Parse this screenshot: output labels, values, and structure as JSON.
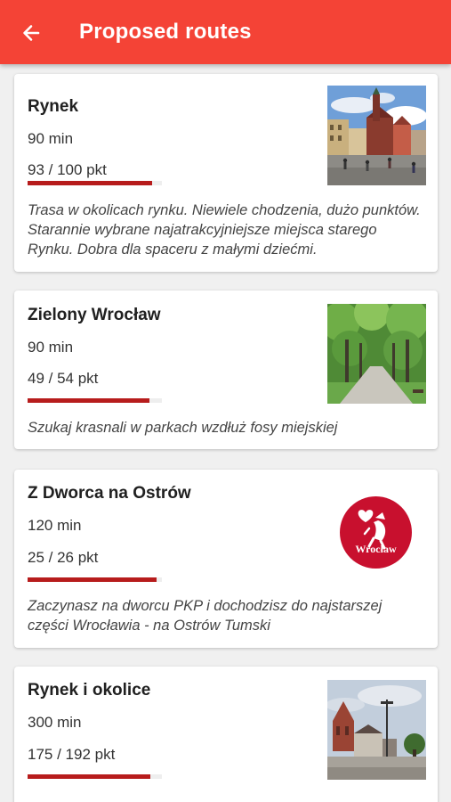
{
  "appbar": {
    "title": "Proposed routes",
    "back_icon": "arrow-left-icon",
    "color": "#f44336"
  },
  "accent_color": "#b71c1c",
  "routes": [
    {
      "name": "Rynek",
      "duration": "90 min",
      "points": "93 / 100 pkt",
      "progress": 0.93,
      "description": "Trasa w okolicach rynku. Niewiele chodzenia, dużo punktów. Starannie wybrane najatrakcyjniejsze miejsca starego Rynku. Dobra dla spaceru z małymi dziećmi.",
      "image": "market-square-photo"
    },
    {
      "name": "Zielony Wrocław",
      "duration": "90 min",
      "points": "49 / 54 pkt",
      "progress": 0.907,
      "description": "Szukaj krasnali w parkach wzdłuż fosy miejskiej",
      "image": "park-alley-photo"
    },
    {
      "name": "Z Dworca na Ostrów",
      "duration": "120 min",
      "points": "25 / 26 pkt",
      "progress": 0.96,
      "description": "Zaczynasz na dworcu PKP i dochodzisz do najstarszej części Wrocławia - na Ostrów Tumski",
      "image": "wroclaw-logo",
      "logo_text": "Wrocław"
    },
    {
      "name": "Rynek i okolice",
      "duration": "300 min",
      "points": "175 / 192 pkt",
      "progress": 0.911,
      "description": "",
      "image": "church-street-photo"
    }
  ]
}
